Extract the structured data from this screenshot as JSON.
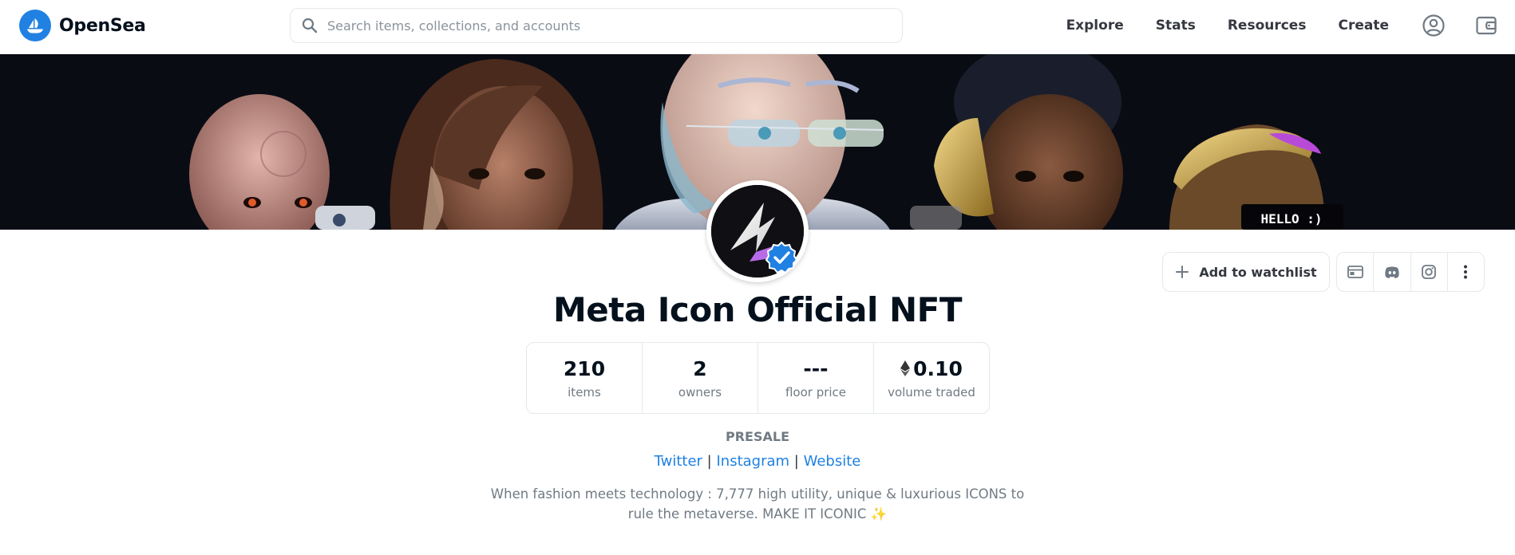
{
  "header": {
    "brand": "OpenSea",
    "search_placeholder": "Search items, collections, and accounts",
    "nav": [
      "Explore",
      "Stats",
      "Resources",
      "Create"
    ],
    "icons": [
      "account-icon",
      "wallet-icon"
    ]
  },
  "collection": {
    "banner_text": "HELLO :)",
    "name": "Meta Icon Official NFT",
    "verified": true,
    "watchlist_label": "Add to watchlist",
    "social_icons": [
      "website-icon",
      "discord-icon",
      "instagram-icon",
      "more-icon"
    ],
    "stats": [
      {
        "value": "210",
        "label": "items"
      },
      {
        "value": "2",
        "label": "owners"
      },
      {
        "value": "---",
        "label": "floor price"
      },
      {
        "value": "0.10",
        "label": "volume traded",
        "currency": "eth"
      }
    ],
    "presale": "PRESALE",
    "links": [
      "Twitter",
      "Instagram",
      "Website"
    ],
    "link_separator": "|",
    "description": "When fashion meets technology : 7,777 high utility, unique & luxurious ICONS to rule the metaverse. MAKE IT ICONIC ✨"
  },
  "colors": {
    "accent": "#2081e2",
    "text": "#04111d",
    "muted": "#707a83",
    "border": "#e5e8eb"
  }
}
